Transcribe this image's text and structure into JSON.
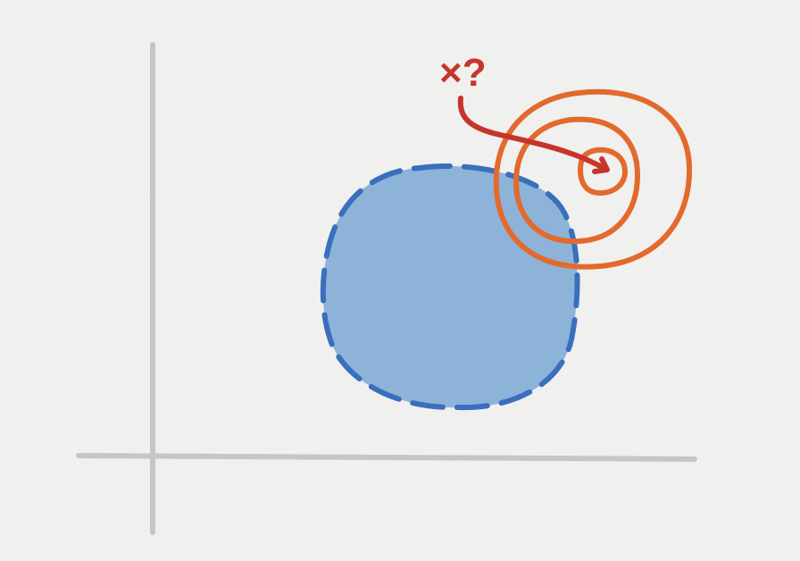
{
  "annotation": {
    "text": "×?"
  },
  "colors": {
    "background": "#f2f2f1",
    "axes": "#c6c6c6",
    "feasible_fill": "#8db3d9",
    "feasible_border": "#3a6fbd",
    "contours": "#e36a2c",
    "arrow": "#c7352a"
  },
  "icons": {
    "axes": "axes-lines",
    "region": "dashed-blob",
    "contours": "concentric-rings",
    "arrow": "curved-arrow"
  }
}
